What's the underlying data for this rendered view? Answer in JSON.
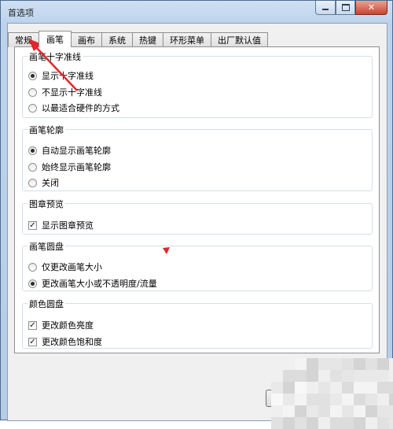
{
  "window": {
    "title": "首选项",
    "controls": {
      "min_icon": "minimize-icon",
      "max_icon": "maximize-icon",
      "close_glyph": "✕"
    }
  },
  "tabs": [
    {
      "label": "常规",
      "selected": false
    },
    {
      "label": "画笔",
      "selected": true
    },
    {
      "label": "画布",
      "selected": false
    },
    {
      "label": "系统",
      "selected": false
    },
    {
      "label": "热键",
      "selected": false
    },
    {
      "label": "环形菜单",
      "selected": false
    },
    {
      "label": "出厂默认值",
      "selected": false
    }
  ],
  "groups": {
    "crosshair": {
      "title": "画笔十字准线",
      "options": [
        {
          "label": "显示十字准线",
          "checked": true
        },
        {
          "label": "不显示十字准线",
          "checked": false
        },
        {
          "label": "以最适合硬件的方式",
          "checked": false
        }
      ]
    },
    "outline": {
      "title": "画笔轮廓",
      "options": [
        {
          "label": "自动显示画笔轮廓",
          "checked": true
        },
        {
          "label": "始终显示画笔轮廓",
          "checked": false
        },
        {
          "label": "关闭",
          "checked": false
        }
      ]
    },
    "stamp_preview": {
      "title": "图章预览",
      "options": [
        {
          "label": "显示图章预览",
          "checked": true
        }
      ]
    },
    "brush_puck": {
      "title": "画笔圆盘",
      "options": [
        {
          "label": "仅更改画笔大小",
          "checked": false
        },
        {
          "label": "更改画笔大小或不透明度/流量",
          "checked": true
        }
      ]
    },
    "color_puck": {
      "title": "颜色圆盘",
      "options": [
        {
          "label": "更改颜色亮度",
          "checked": true
        },
        {
          "label": "更改颜色饱和度",
          "checked": true
        }
      ]
    }
  },
  "colors": {
    "annotation_arrow": "#e2262b",
    "frame": "#bcd3ec",
    "close_button": "#c7452f"
  }
}
